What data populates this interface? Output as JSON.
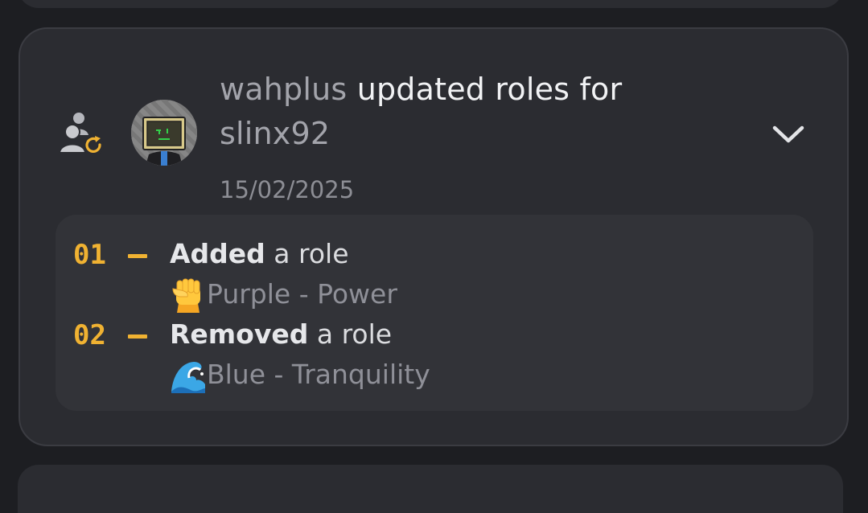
{
  "entry": {
    "actor": "wahplus",
    "action_text": "updated roles for",
    "target": "slinx92",
    "date": "15/02/2025",
    "icons": {
      "action": "member-role-update-icon",
      "expand": "chevron-down-icon"
    },
    "colors": {
      "accent": "#f0b232",
      "card": "#2b2c31",
      "changes_bg": "#323338"
    }
  },
  "changes": [
    {
      "number": "01",
      "verb": "Added",
      "object": "a role",
      "role_emoji": "raised-fist-emoji",
      "role_name": "Purple - Power"
    },
    {
      "number": "02",
      "verb": "Removed",
      "object": "a role",
      "role_emoji": "water-wave-emoji",
      "role_name": "Blue - Tranquility"
    }
  ]
}
